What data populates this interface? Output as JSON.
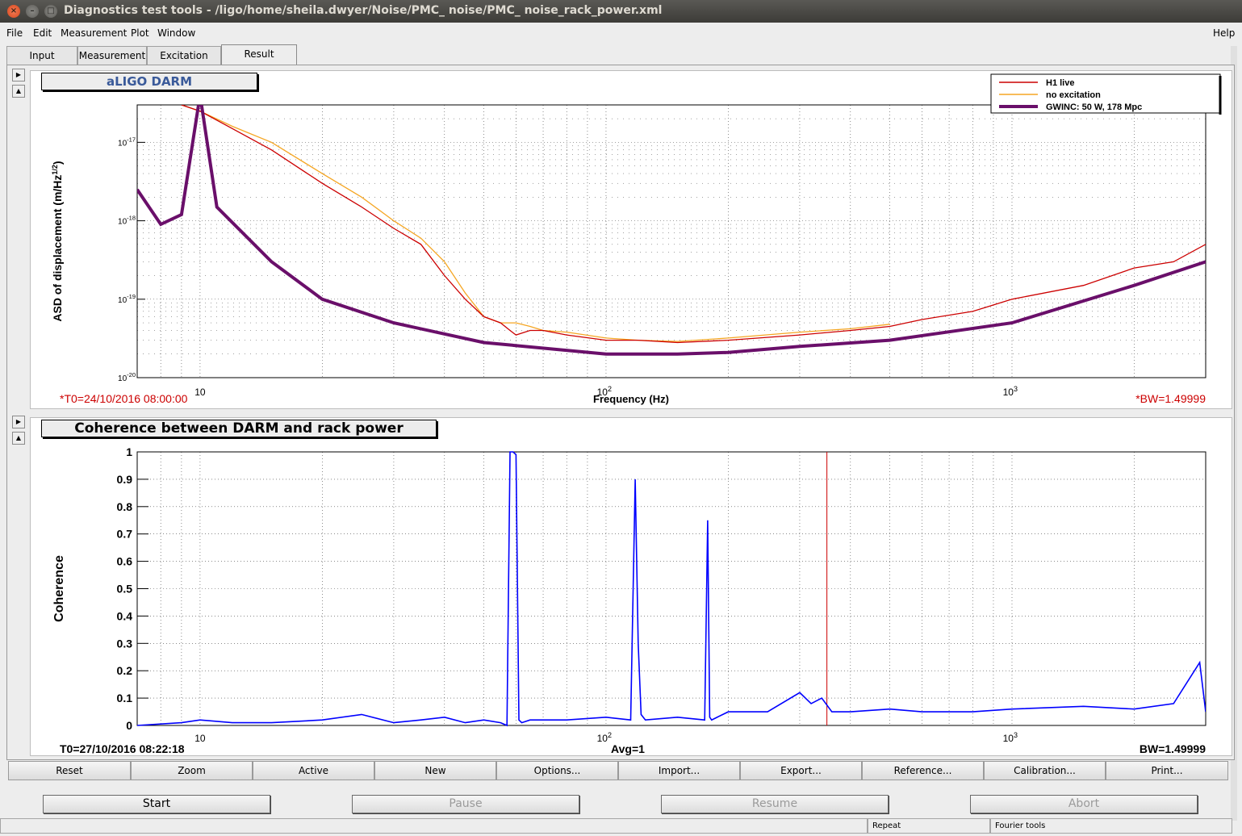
{
  "window": {
    "title": "Diagnostics test tools - /ligo/home/sheila.dwyer/Noise/PMC_ noise/PMC_ noise_rack_power.xml"
  },
  "menu": {
    "file": "File",
    "edit": "Edit",
    "measurement": "Measurement",
    "plot": "Plot",
    "window": "Window",
    "help": "Help"
  },
  "tabs": {
    "input": "Input",
    "measurement": "Measurement",
    "excitation": "Excitation",
    "result": "Result"
  },
  "colors": {
    "h1_live": "#cc0000",
    "no_excitation": "#f5a623",
    "gwinc": "#6a0f6a",
    "coherence": "#0000ff",
    "cursor": "#cc0000"
  },
  "plot1": {
    "title": "aLIGO DARM",
    "ylabel": "ASD of displacement (m/Hz",
    "ylabel_sup": "1/2",
    "ylabel_end": ")",
    "xlabel": "Frequency (Hz)",
    "t0": "*T0=24/10/2016 08:00:00",
    "bw": "*BW=1.49999",
    "ytick_base": "10",
    "yticks_exp": [
      "-17",
      "-18",
      "-19",
      "-20"
    ],
    "xtick_10": "10",
    "xtick_100_base": "10",
    "xtick_100_exp": "2",
    "xtick_1000_base": "10",
    "xtick_1000_exp": "3",
    "legend": [
      "H1 live",
      "no excitation",
      "GWINC: 50 W, 178 Mpc"
    ]
  },
  "plot2": {
    "title": "Coherence between DARM and rack power",
    "ylabel": "Coherence",
    "t0": "T0=27/10/2016 08:22:18",
    "avg": "Avg=1",
    "bw": "BW=1.49999",
    "yticks": [
      "1",
      "0.9",
      "0.8",
      "0.7",
      "0.6",
      "0.5",
      "0.4",
      "0.3",
      "0.2",
      "0.1",
      "0"
    ],
    "xtick_10": "10",
    "xtick_100_base": "10",
    "xtick_100_exp": "2",
    "xtick_1000_base": "10",
    "xtick_1000_exp": "3"
  },
  "chart_data": [
    {
      "type": "line",
      "title": "aLIGO DARM",
      "xlabel": "Frequency (Hz)",
      "ylabel": "ASD of displacement (m/Hz^1/2)",
      "xscale": "log",
      "yscale": "log",
      "xlim": [
        7,
        3000
      ],
      "ylim": [
        1e-20,
        3e-17
      ],
      "grid": true,
      "legend_position": "top-right",
      "series": [
        {
          "name": "H1 live",
          "x": [
            9,
            10,
            12,
            15,
            20,
            25,
            30,
            35,
            40,
            45,
            50,
            55,
            58,
            60,
            65,
            70,
            80,
            100,
            120,
            150,
            200,
            300,
            400,
            500,
            600,
            800,
            1000,
            1500,
            2000,
            2500,
            3000
          ],
          "y": [
            3e-17,
            2.5e-17,
            1.5e-17,
            8e-18,
            3e-18,
            1.5e-18,
            8e-19,
            5e-19,
            2e-19,
            1e-19,
            6e-20,
            5e-20,
            4e-20,
            3.5e-20,
            4e-20,
            4e-20,
            3.5e-20,
            3e-20,
            3e-20,
            2.8e-20,
            3e-20,
            3.5e-20,
            4e-20,
            4.5e-20,
            5.5e-20,
            7e-20,
            1e-19,
            1.5e-19,
            2.5e-19,
            3e-19,
            5e-19
          ]
        },
        {
          "name": "no excitation",
          "x": [
            9,
            10,
            12,
            15,
            20,
            25,
            30,
            35,
            40,
            45,
            50,
            55,
            60,
            65,
            70,
            80,
            100,
            120,
            150,
            200,
            300,
            400,
            500
          ],
          "y": [
            3e-17,
            2.5e-17,
            1.6e-17,
            1e-17,
            4e-18,
            2e-18,
            1e-18,
            6e-19,
            3e-19,
            1.2e-19,
            6e-20,
            5e-20,
            5e-20,
            4.5e-20,
            4e-20,
            3.8e-20,
            3.2e-20,
            3e-20,
            2.9e-20,
            3.2e-20,
            3.8e-20,
            4.2e-20,
            4.8e-20
          ]
        },
        {
          "name": "GWINC: 50 W, 178 Mpc",
          "x": [
            7,
            8,
            9,
            10,
            11,
            15,
            20,
            30,
            50,
            100,
            150,
            200,
            300,
            500,
            1000,
            2000,
            3000
          ],
          "y": [
            2.5e-18,
            9e-19,
            1.2e-18,
            4e-17,
            1.5e-18,
            3e-19,
            1e-19,
            5e-20,
            2.8e-20,
            2e-20,
            2e-20,
            2.1e-20,
            2.5e-20,
            3e-20,
            5e-20,
            1.5e-19,
            3e-19
          ]
        }
      ]
    },
    {
      "type": "line",
      "title": "Coherence between DARM and rack power",
      "ylabel": "Coherence",
      "xscale": "log",
      "xlim": [
        7,
        3000
      ],
      "ylim": [
        0,
        1
      ],
      "grid": true,
      "series": [
        {
          "x": [
            7,
            9,
            10,
            12,
            15,
            20,
            25,
            30,
            35,
            40,
            45,
            50,
            55,
            57,
            58,
            59,
            60,
            61,
            62,
            65,
            80,
            100,
            115,
            118,
            120,
            122,
            125,
            150,
            175,
            178,
            180,
            182,
            200,
            250,
            300,
            320,
            340,
            360,
            400,
            500,
            600,
            800,
            1000,
            1500,
            2000,
            2500,
            2900,
            3000
          ],
          "y": [
            0.0,
            0.01,
            0.02,
            0.01,
            0.01,
            0.02,
            0.04,
            0.01,
            0.02,
            0.03,
            0.01,
            0.02,
            0.01,
            0.0,
            1.0,
            1.0,
            0.99,
            0.02,
            0.01,
            0.02,
            0.02,
            0.03,
            0.02,
            0.9,
            0.3,
            0.04,
            0.02,
            0.03,
            0.02,
            0.75,
            0.03,
            0.02,
            0.05,
            0.05,
            0.12,
            0.08,
            0.1,
            0.05,
            0.05,
            0.06,
            0.05,
            0.05,
            0.06,
            0.07,
            0.06,
            0.08,
            0.23,
            0.05
          ]
        }
      ]
    }
  ],
  "buttons": [
    "Reset",
    "Zoom",
    "Active",
    "New",
    "Options...",
    "Import...",
    "Export...",
    "Reference...",
    "Calibration...",
    "Print..."
  ],
  "controls": {
    "start": "Start",
    "pause": "Pause",
    "resume": "Resume",
    "abort": "Abort"
  },
  "status": {
    "repeat": "Repeat",
    "mode": "Fourier tools"
  }
}
